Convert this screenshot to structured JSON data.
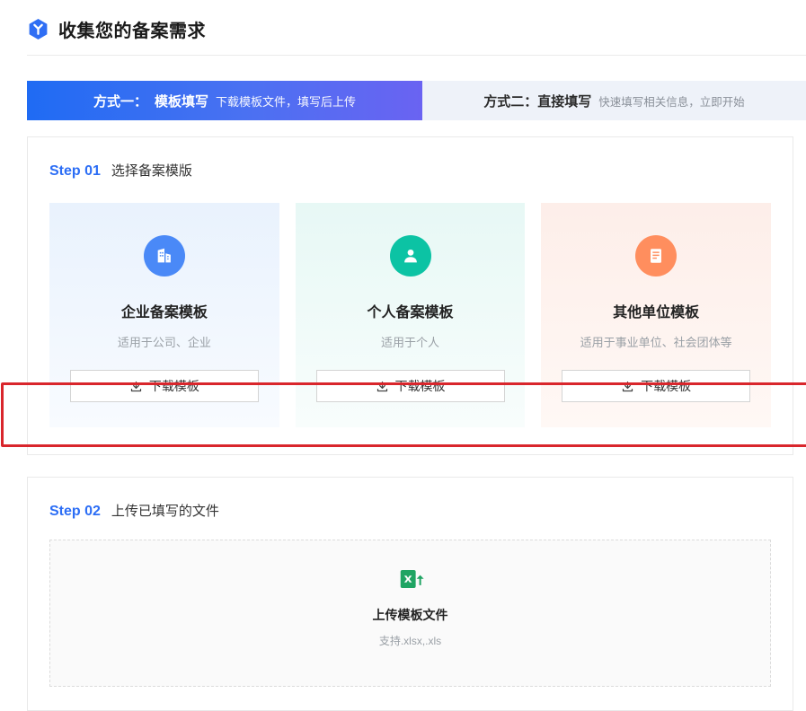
{
  "page": {
    "title": "收集您的备案需求"
  },
  "tabs": {
    "method1": {
      "label": "方式一：",
      "name": "模板填写",
      "desc": "下载模板文件，填写后上传"
    },
    "method2": {
      "label": "方式二：",
      "name": "直接填写",
      "desc": "快速填写相关信息，立即开始"
    }
  },
  "step1": {
    "step": "Step 01",
    "title": "选择备案模版",
    "cards": [
      {
        "icon": "building-icon",
        "title": "企业备案模板",
        "desc": "适用于公司、企业",
        "button": "下载模板",
        "accent": "#4a89f7"
      },
      {
        "icon": "person-icon",
        "title": "个人备案模板",
        "desc": "适用于个人",
        "button": "下载模板",
        "accent": "#0cc3a4"
      },
      {
        "icon": "document-icon",
        "title": "其他单位模板",
        "desc": "适用于事业单位、社会团体等",
        "button": "下载模板",
        "accent": "#ff8e5e"
      }
    ]
  },
  "step2": {
    "step": "Step 02",
    "title": "上传已填写的文件",
    "upload": {
      "title": "上传模板文件",
      "hint": "支持.xlsx,.xls"
    }
  },
  "colors": {
    "accent_blue": "#2b6df5",
    "banner_gradient_start": "#1f6bf3",
    "banner_gradient_end": "#6a63f2",
    "annotation_red": "#d9262c",
    "excel_green": "#1fa463"
  }
}
